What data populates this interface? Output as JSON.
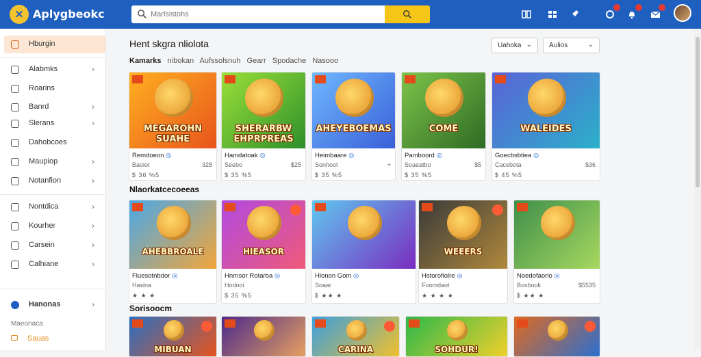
{
  "app": {
    "title": "Aplygbeokc",
    "logo": "logo-icon"
  },
  "search": {
    "placeholder": "Marlsistohs",
    "button_icon": "search-icon"
  },
  "top_icons": [
    "library-icon",
    "grid-icon",
    "rocket-icon",
    "notification-icon",
    "bell-icon",
    "mail-icon"
  ],
  "sidebar": {
    "items": [
      {
        "label": "Hburgin",
        "icon": "home-icon",
        "active": true,
        "chevron": false
      },
      {
        "label": "Alabmks",
        "icon": "image-icon",
        "active": false,
        "chevron": true
      },
      {
        "label": "Roarins",
        "icon": "shield-icon",
        "active": false,
        "chevron": false
      },
      {
        "label": "Banrd",
        "icon": "chat-icon",
        "active": false,
        "chevron": true
      },
      {
        "label": "Slerans",
        "icon": "list-icon",
        "active": false,
        "chevron": true
      },
      {
        "label": "Dahobcoes",
        "icon": "doc-icon",
        "active": false,
        "chevron": false
      },
      {
        "label": "Maupiop",
        "icon": "camera-icon",
        "active": false,
        "chevron": true
      },
      {
        "label": "Notanfion",
        "icon": "calendar-icon",
        "active": false,
        "chevron": true
      },
      {
        "label": "Nontdica",
        "icon": "folder-icon",
        "active": false,
        "chevron": true
      },
      {
        "label": "Kourher",
        "icon": "bookmark-icon",
        "active": false,
        "chevron": true
      },
      {
        "label": "Carsein",
        "icon": "clock-icon",
        "active": false,
        "chevron": true
      },
      {
        "label": "Calhiane",
        "icon": "gallery-icon",
        "active": false,
        "chevron": true
      },
      {
        "label": "Hanonas",
        "icon": "google-icon",
        "active": false,
        "chevron": true
      }
    ],
    "sub_label": "Maeonaca",
    "orange_label": "Sauas"
  },
  "main": {
    "title": "Hent skgra nliolota",
    "dropdowns": [
      "Uahoka",
      "Aulios"
    ],
    "filters": [
      "Kamarks",
      "nibokan",
      "Aufssolsnuh",
      "Gearr",
      "Spodache",
      "Nasooo"
    ],
    "section2_title": "Nlaorkatcecoeeas",
    "section3_title": "Sorisoocm"
  },
  "row1": [
    {
      "name": "Remdoeon",
      "sub": "Baoiot",
      "right": "328",
      "stats": "$ 36 %5",
      "thumb_title": "MEGAROHN SUAHE",
      "c1": "#ffb020",
      "c2": "#e8541c"
    },
    {
      "name": "Hamdatoak",
      "sub": "Seebo",
      "right": "$25",
      "stats": "$ 35 %5",
      "thumb_title": "SHERARBW EHPRPREAS",
      "c1": "#9be03a",
      "c2": "#2d8f2a"
    },
    {
      "name": "Heimbaare",
      "sub": "Sonhoot",
      "right": "+",
      "stats": "$ 35 %5",
      "thumb_title": "AHEYEBOEMAS",
      "c1": "#6fb8ff",
      "c2": "#3a5fd8"
    },
    {
      "name": "Pamboord",
      "sub": "Soaeatbo",
      "right": "$5",
      "stats": "$ 35 %5",
      "thumb_title": "COME",
      "c1": "#7cc54a",
      "c2": "#2f6a24"
    },
    {
      "name": "Goecbsbtiea",
      "sub": "Cacebota",
      "right": "$36",
      "stats": "$ 45 %5",
      "thumb_title": "WALEIDES",
      "c1": "#5a63d8",
      "c2": "#2bb0c9"
    }
  ],
  "row2": [
    {
      "name": "Fluesotnbdor",
      "sub": "Hasina",
      "stats": "★ ★ ★",
      "thumb_title": "AHEBBROALE",
      "c1": "#4aa8e8",
      "c2": "#f2a53a"
    },
    {
      "name": "Hnrnsor Rotarba",
      "sub": "Hodooi",
      "stats": "$ 35 %5",
      "thumb_title": "HIEASOR",
      "c1": "#b04ae0",
      "c2": "#f05a7a"
    },
    {
      "name": "Hlonon Gom",
      "sub": "Soaar",
      "stats": "$ ★★ ★",
      "thumb_title": "",
      "c1": "#5fc7f0",
      "c2": "#7a2cc0"
    },
    {
      "name": "Hstorofiolre",
      "sub": "Foomdaot",
      "stats": "★ ★ ★ ★",
      "thumb_title": "WEEERS",
      "c1": "#3a3a3a",
      "c2": "#b0893c"
    },
    {
      "name": "Noedofaorlo",
      "sub": "Bosbook",
      "right": "$5535",
      "stats": "$ ★★ ★",
      "thumb_title": "",
      "c1": "#3e8f4a",
      "c2": "#a8d860"
    }
  ],
  "row3": [
    {
      "thumb_title": "MIBUAN",
      "c1": "#2a6fc2",
      "c2": "#e8541c"
    },
    {
      "thumb_title": "",
      "c1": "#4a2a8a",
      "c2": "#e8a060"
    },
    {
      "thumb_title": "CARINA",
      "c1": "#3aa0e0",
      "c2": "#f2c02a"
    },
    {
      "thumb_title": "SOHDUR!",
      "c1": "#2bb84a",
      "c2": "#f2d02a"
    },
    {
      "thumb_title": "",
      "c1": "#e06a20",
      "c2": "#2a6fd0"
    }
  ],
  "colors": {
    "topbar": "#1e5fbf",
    "accent": "#f5c518",
    "active_bg": "#fde7d4"
  }
}
